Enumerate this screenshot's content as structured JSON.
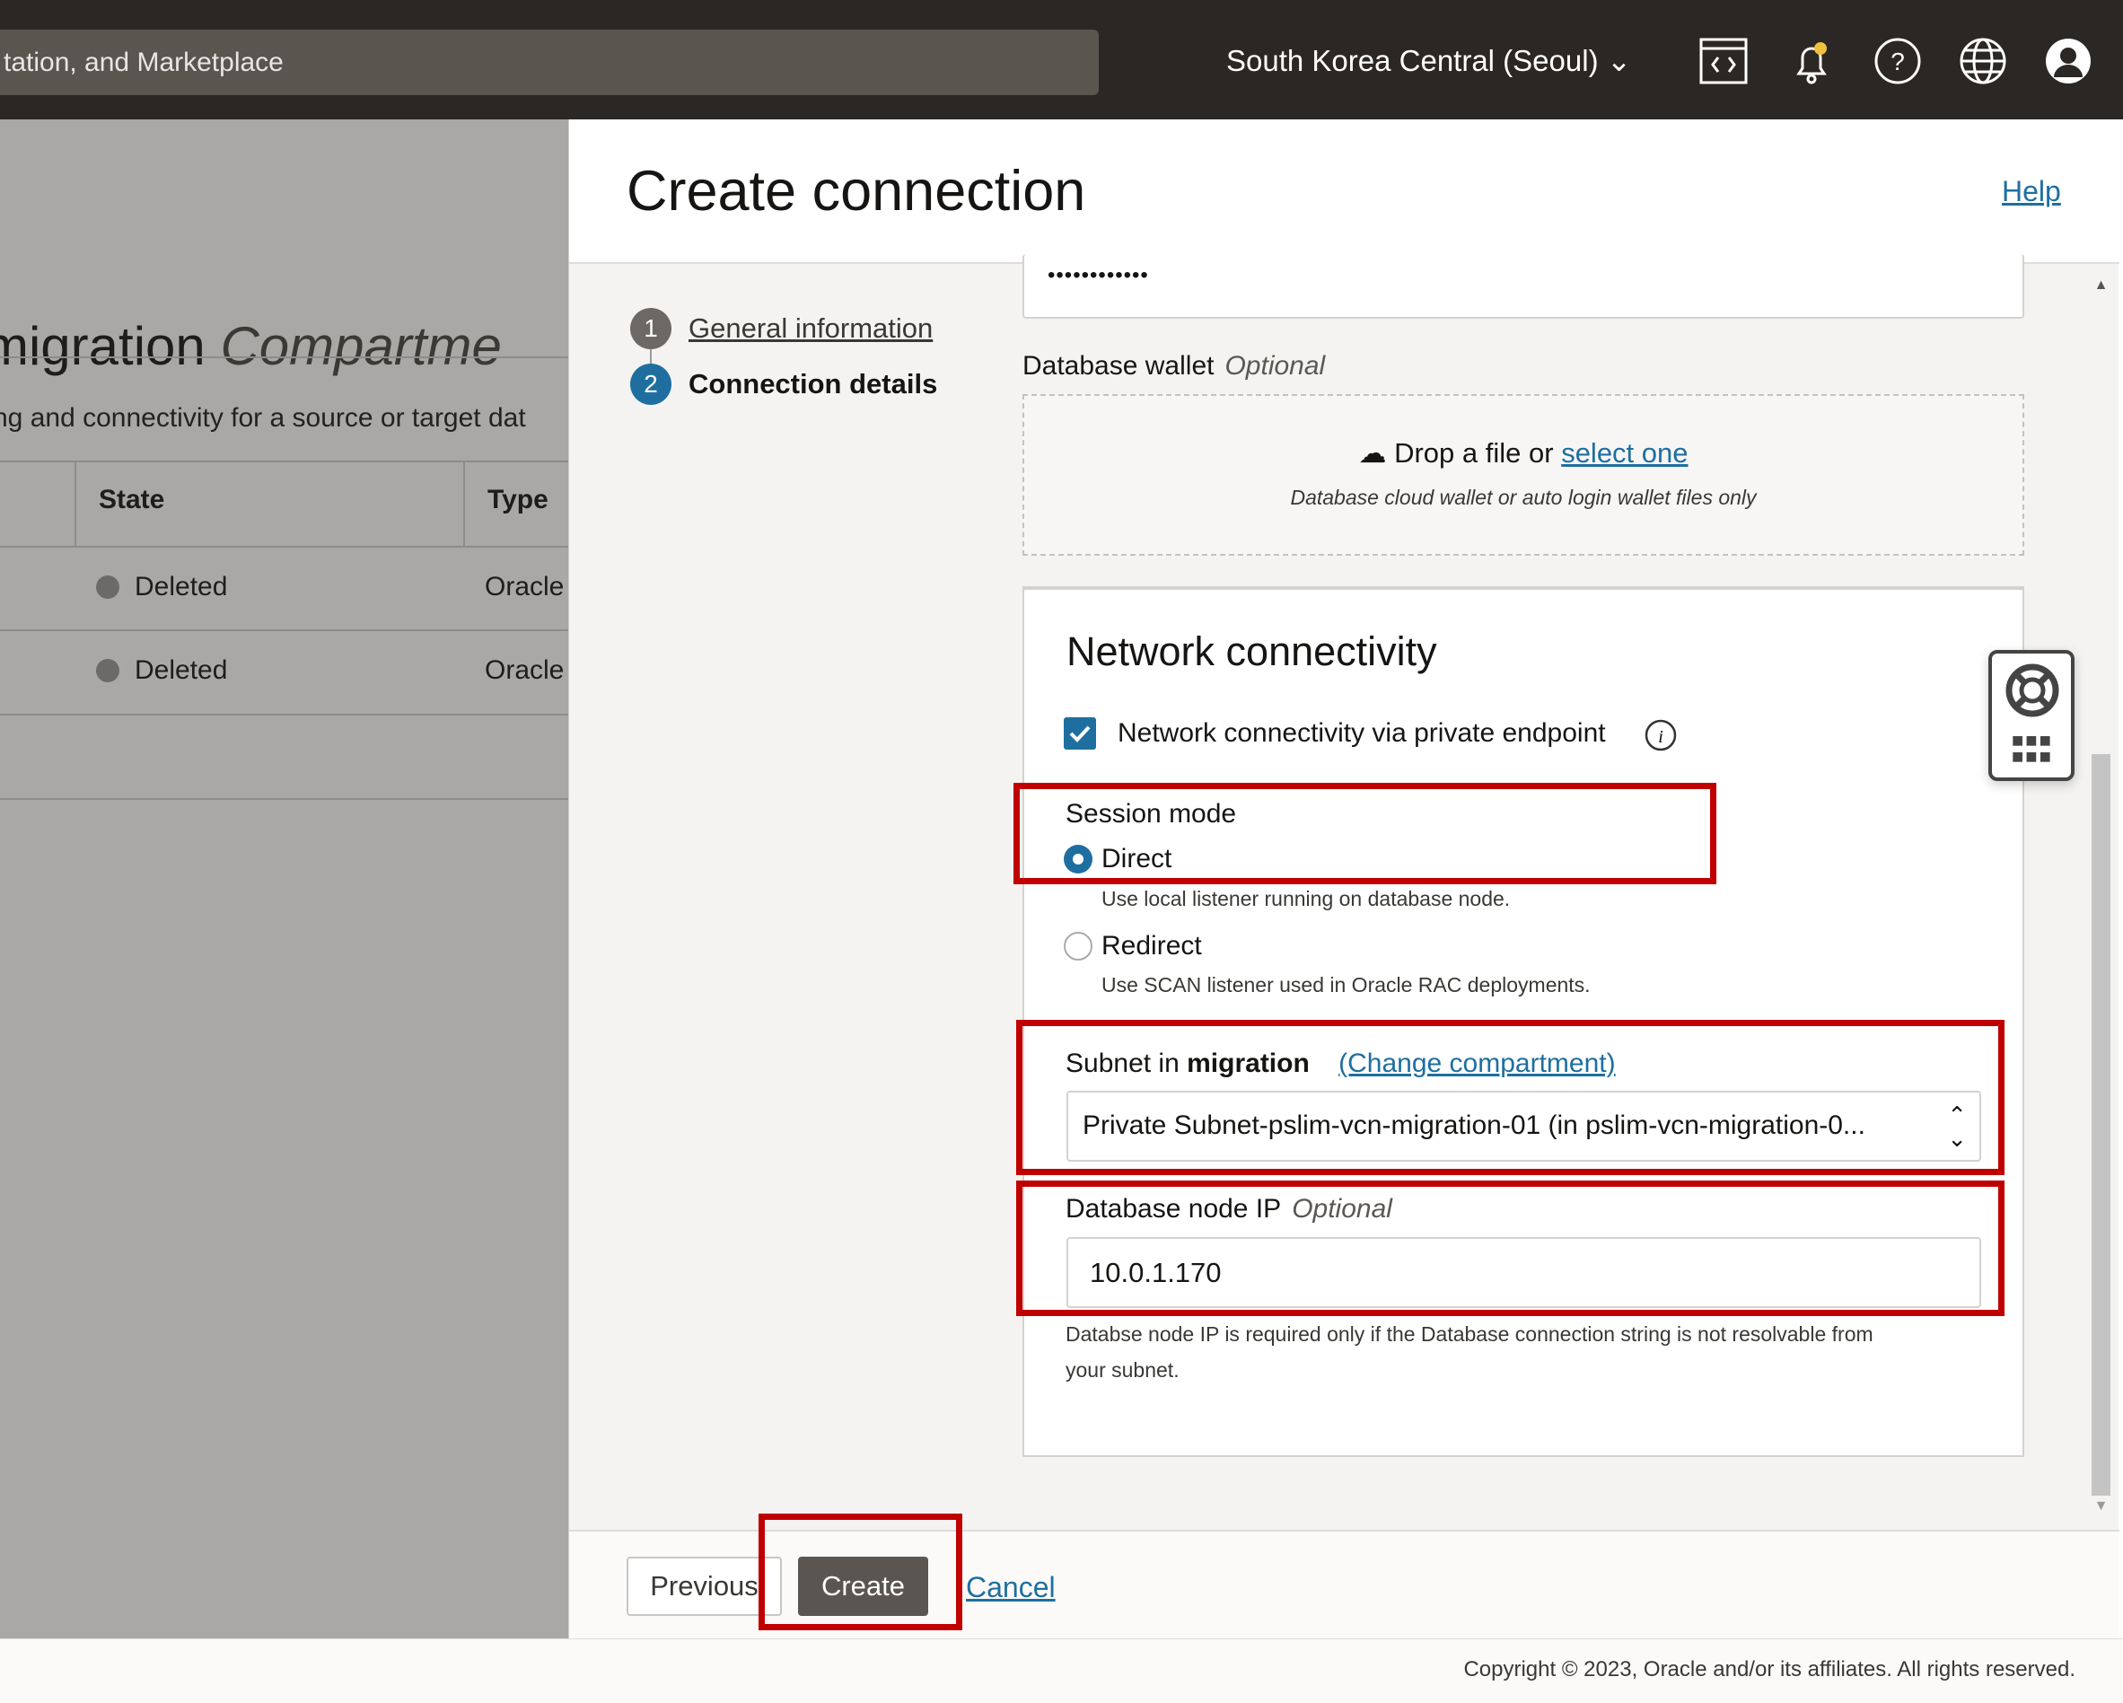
{
  "topbar": {
    "search_text": "tation, and Marketplace",
    "region": "South Korea Central (Seoul)",
    "icons": [
      "code-editor-icon",
      "bell-icon",
      "help-icon",
      "globe-icon",
      "user-avatar-icon"
    ],
    "notification_color": "#f0c040"
  },
  "background_page": {
    "title": "migration",
    "title_suffix": "Compartme",
    "subtitle": "ng and connectivity for a source or target dat",
    "columns": [
      "State",
      "Type"
    ],
    "rows": [
      {
        "state": "Deleted",
        "type": "Oracle"
      },
      {
        "state": "Deleted",
        "type": "Oracle"
      }
    ]
  },
  "panel": {
    "title": "Create connection",
    "help": "Help",
    "steps": [
      {
        "num": "1",
        "label": "General information"
      },
      {
        "num": "2",
        "label": "Connection details"
      }
    ],
    "password_value": "••••••••••••",
    "wallet": {
      "label": "Database wallet",
      "optional": "Optional",
      "drop_text": "Drop a file or",
      "select_link": "select one",
      "hint": "Database cloud wallet or auto login wallet files only"
    },
    "network": {
      "title": "Network connectivity",
      "checkbox_label": "Network connectivity via private endpoint",
      "checkbox_checked": true,
      "session_mode_label": "Session mode",
      "options": [
        {
          "label": "Direct",
          "desc": "Use local listener running on database node.",
          "selected": true
        },
        {
          "label": "Redirect",
          "desc": "Use SCAN listener used in Oracle RAC deployments.",
          "selected": false
        }
      ],
      "subnet_label": "Subnet in",
      "subnet_compartment": "migration",
      "change_compartment": "(Change compartment)",
      "subnet_value": "Private Subnet-pslim-vcn-migration-01 (in pslim-vcn-migration-0...",
      "node_ip_label": "Database node IP",
      "node_ip_optional": "Optional",
      "node_ip_value": "10.0.1.170",
      "node_ip_help": "Databse node IP is required only if the Database connection string is not resolvable from",
      "node_ip_help2": "your subnet."
    },
    "footer": {
      "previous": "Previous",
      "create": "Create",
      "cancel": "Cancel"
    }
  },
  "copyright": "Copyright © 2023, Oracle and/or its affiliates. All rights reserved.",
  "colors": {
    "accent": "#1e6fa0",
    "highlight": "#c00000",
    "create_button": "#5b5551"
  }
}
